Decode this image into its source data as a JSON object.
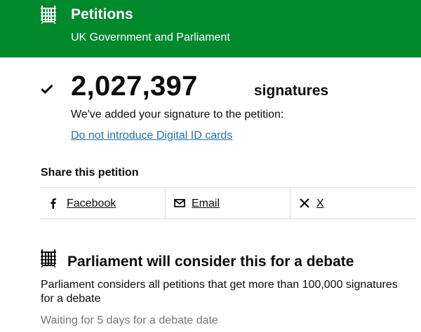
{
  "header": {
    "title": "Petitions",
    "subtitle": "UK Government and Parliament",
    "background_color": "#00892d",
    "icon": "portcullis-icon"
  },
  "signatures": {
    "count": "2,027,397",
    "label": "signatures",
    "icon": "checkmark-icon"
  },
  "confirmation": {
    "message": "We've added your signature to the petition:",
    "petition_title": "Do not introduce Digital ID cards",
    "link_color": "#1d70b8"
  },
  "share": {
    "heading": "Share this petition",
    "items": [
      {
        "label": "Facebook",
        "icon": "facebook-icon"
      },
      {
        "label": "Email",
        "icon": "email-icon"
      },
      {
        "label": "X",
        "icon": "x-icon"
      }
    ]
  },
  "debate": {
    "icon": "portcullis-icon",
    "heading": "Parliament will consider this for a debate",
    "description": "Parliament considers all petitions that get more than 100,000 signatures for a debate",
    "status": "Waiting for 5 days for a debate date",
    "status_color": "#6f777b"
  }
}
